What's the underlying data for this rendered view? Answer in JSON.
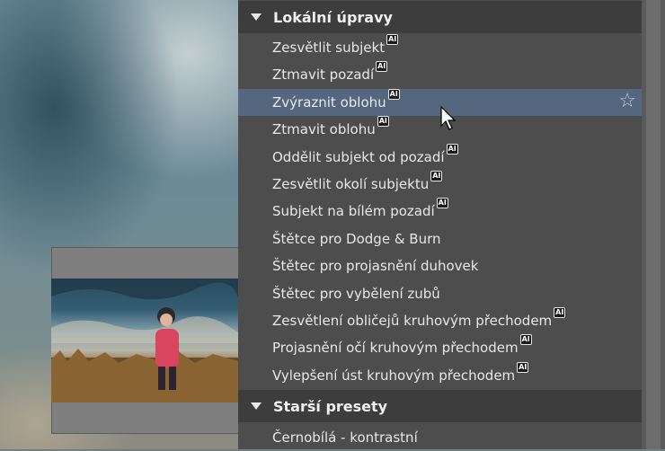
{
  "sections": [
    {
      "title": "Lokální úpravy",
      "items": [
        {
          "label": "Zesvětlit subjekt",
          "ai": true
        },
        {
          "label": "Ztmavit pozadí",
          "ai": true
        },
        {
          "label": "Zvýraznit oblohu",
          "ai": true,
          "selected": true
        },
        {
          "label": "Ztmavit oblohu",
          "ai": true
        },
        {
          "label": "Oddělit subjekt od pozadí",
          "ai": true
        },
        {
          "label": "Zesvětlit okolí subjektu",
          "ai": true
        },
        {
          "label": "Subjekt na bílém pozadí",
          "ai": true
        },
        {
          "label": "Štětce pro Dodge & Burn",
          "ai": false
        },
        {
          "label": "Štětec pro projasnění duhovek",
          "ai": false
        },
        {
          "label": "Štětec pro vybělení zubů",
          "ai": false
        },
        {
          "label": "Zesvětlení obličejů kruhovým přechodem",
          "ai": true
        },
        {
          "label": "Projasnění očí kruhovým přechodem",
          "ai": true
        },
        {
          "label": "Vylepšení úst kruhovým přechodem",
          "ai": true
        }
      ]
    },
    {
      "title": "Starší presety",
      "items": [
        {
          "label": "Černobílá - kontrastní",
          "ai": false
        }
      ]
    }
  ],
  "badge_text": "AI",
  "icons": {
    "favorite": "star-outline-icon",
    "expand": "caret-down-icon",
    "pointer": "mouse-cursor-icon"
  },
  "colors": {
    "panel": "#4d4d4d",
    "header": "#3d3d3d",
    "selected": "#55667f",
    "text": "#e8e8e8"
  }
}
